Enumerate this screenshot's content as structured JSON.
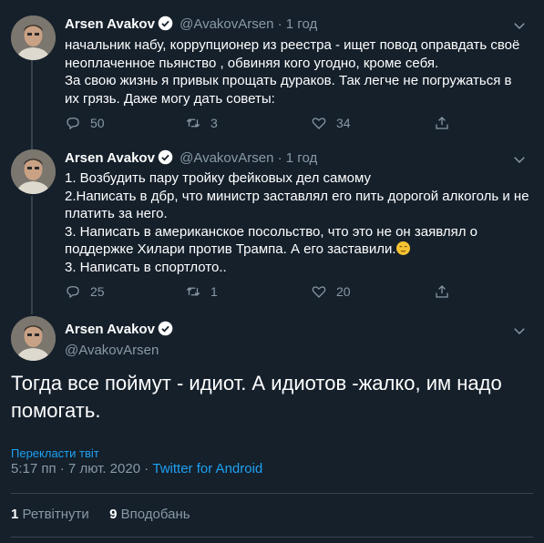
{
  "colors": {
    "background": "#15202b",
    "text": "#ffffff",
    "muted": "#8899a6",
    "link": "#1da1f2",
    "border": "#38444d"
  },
  "tweets": [
    {
      "display_name": "Arsen Avakov",
      "handle": "@AvakovArsen",
      "separator": "·",
      "time": "1 год",
      "text": "начальник набу, коррупционер из реестра - ищет повод оправдать своё неоплаченное пьянство , обвиняя кого угодно, кроме себя.\nЗа свою жизнь я привык прощать дураков. Так легче не погружаться в их грязь. Даже могу дать советы:",
      "replies": "50",
      "retweets": "3",
      "likes": "34"
    },
    {
      "display_name": "Arsen Avakov",
      "handle": "@AvakovArsen",
      "separator": "·",
      "time": "1 год",
      "text_lines": [
        "1. Возбудить пару тройку фейковых дел  самому",
        "2.Написать в дбр, что министр заставлял его пить дорогой алкоголь и не платить за него.",
        "3. Написать в американское посольство, что это не он заявлял о поддержке Хилари против Трампа.  А его заставили.",
        "3. Написать в спортлото.."
      ],
      "replies": "25",
      "retweets": "1",
      "likes": "20"
    }
  ],
  "main_tweet": {
    "display_name": "Arsen Avakov",
    "handle": "@AvakovArsen",
    "text": "Тогда все поймут - идиот. А идиотов -жалко, им надо помогать.",
    "translate_label": "Перекласти твіт",
    "time": "5:17 пп · 7 лют. 2020 · ",
    "source": "Twitter for Android",
    "retweet_count": "1",
    "retweet_label": "Ретвітнути",
    "like_count": "9",
    "like_label": "Вподобань"
  }
}
